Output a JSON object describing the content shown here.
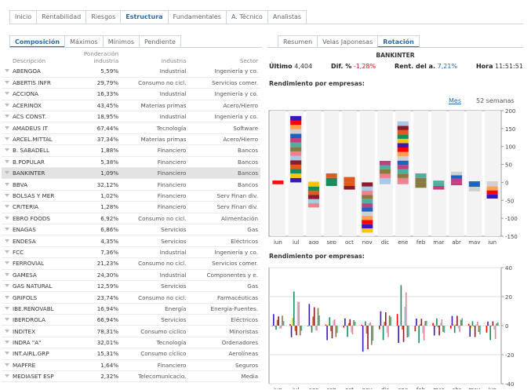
{
  "top_tabs": [
    "Inicio",
    "Rentabilidad",
    "Riesgos",
    "Estructura",
    "Fundamentales",
    "A. Técnico",
    "Analistas"
  ],
  "top_active": 3,
  "sub_tabs": [
    "Composición",
    "Máximos",
    "Mínimos",
    "Pendiente"
  ],
  "sub_active": 0,
  "table": {
    "headers": [
      "Descripción",
      "Ponderación industria",
      "Industria",
      "Sector"
    ],
    "rows": [
      [
        "ABENGOA",
        "5,59%",
        "Industrial",
        "Ingeniería y co."
      ],
      [
        "ABERTIS INFR",
        "29,79%",
        "Consumo no cicl.",
        "Servicios comer."
      ],
      [
        "ACCIONA",
        "16,33%",
        "Industrial",
        "Ingeniería y co."
      ],
      [
        "ACERINOX",
        "43,45%",
        "Materias primas",
        "Acero/Hierro"
      ],
      [
        "ACS CONST.",
        "18,95%",
        "Industrial",
        "Ingeniería y co."
      ],
      [
        "AMADEUS IT",
        "67,44%",
        "Tecnología",
        "Software"
      ],
      [
        "ARCEL.MITTAL",
        "37,34%",
        "Materias primas",
        "Acero/Hierro"
      ],
      [
        "B. SABADELL",
        "1,88%",
        "Financiero",
        "Bancos"
      ],
      [
        "B.POPULAR",
        "5,38%",
        "Financiero",
        "Bancos"
      ],
      [
        "BANKINTER",
        "1,09%",
        "Financiero",
        "Bancos"
      ],
      [
        "BBVA",
        "32,12%",
        "Financiero",
        "Bancos"
      ],
      [
        "BOLSAS Y MER",
        "1,02%",
        "Financiero",
        "Serv Finan div."
      ],
      [
        "CRITERIA",
        "1,28%",
        "Financiero",
        "Serv Finan div."
      ],
      [
        "EBRO FOODS",
        "6,92%",
        "Consumo no cicl.",
        "Alimentación"
      ],
      [
        "ENAGAS",
        "6,86%",
        "Servicios",
        "Gas"
      ],
      [
        "ENDESA",
        "4,35%",
        "Servicios",
        "Eléctricos"
      ],
      [
        "FCC",
        "7,36%",
        "Industrial",
        "Ingeniería y co."
      ],
      [
        "FERROVIAL",
        "21,23%",
        "Consumo no cicl.",
        "Servicios comer."
      ],
      [
        "GAMESA",
        "24,30%",
        "Industrial",
        "Componentes y e."
      ],
      [
        "GAS NATURAL",
        "12,59%",
        "Servicios",
        "Gas"
      ],
      [
        "GRIFOLS",
        "23,74%",
        "Consumo no cicl.",
        "Farmacéuticas"
      ],
      [
        "IBE.RENOVABL",
        "16,94%",
        "Energía",
        "Energía-Fuentes."
      ],
      [
        "IBERDROLA",
        "66,94%",
        "Servicios",
        "Eléctricos"
      ],
      [
        "INDITEX",
        "78,31%",
        "Consumo cíclico",
        "Minoristas"
      ],
      [
        "INDRA \"A\"",
        "32,01%",
        "Tecnología",
        "Ordenadores"
      ],
      [
        "INT.AIRL.GRP",
        "15,31%",
        "Consumo cíclico",
        "Aerolíneas"
      ],
      [
        "MAPFRE",
        "1,64%",
        "Financiero",
        "Seguros"
      ],
      [
        "MEDIASET ESP",
        "2,32%",
        "Telecomunicacio.",
        "Media"
      ]
    ],
    "selected_row": 9
  },
  "right_tabs": [
    "Resumen",
    "Velas Japonesas",
    "Rotación"
  ],
  "right_active": 2,
  "detail": {
    "title": "BANKINTER",
    "ultimo_label": "Último",
    "ultimo": "4,404",
    "dif_label": "Dif. %",
    "dif": "-1,28%",
    "rent_label": "Rent. del a.",
    "rent": "7,21%",
    "hora_label": "Hora",
    "hora": "11:51:51"
  },
  "section1": "Rendimiento por empresas:",
  "section2": "Rendimiento por empresas:",
  "period_mes": "Mes",
  "period_52": "52 semanas",
  "colors": {
    "accent": "#2a6aa6",
    "neg": "#cc2020",
    "pos": "#2a6aa6"
  },
  "chart_data": [
    {
      "type": "bar",
      "title": "Rendimiento por empresas:",
      "categories": [
        "jun",
        "jul",
        "ago",
        "sep",
        "oct",
        "nov",
        "dic",
        "ene",
        "feb",
        "mar",
        "abr",
        "may",
        "jun"
      ],
      "stacked": true,
      "ylim": [
        -150,
        200
      ],
      "yticks": [
        200,
        150,
        100,
        50,
        0,
        -50,
        -100,
        -150
      ],
      "positive_totals": [
        5,
        185,
        2,
        25,
        15,
        0,
        60,
        170,
        25,
        5,
        30,
        3,
        3
      ],
      "negative_totals": [
        -5,
        0,
        -70,
        -10,
        -20,
        -140,
        -5,
        -5,
        -15,
        -20,
        -8,
        -25,
        -45
      ],
      "grid": true
    },
    {
      "type": "bar",
      "title": "Rendimiento por empresas:",
      "categories": [
        "jun",
        "jul",
        "ago",
        "sep",
        "oct",
        "nov",
        "dic",
        "ene",
        "feb",
        "mar",
        "abr",
        "may",
        "jun"
      ],
      "ylim": [
        -40,
        40
      ],
      "yticks": [
        40,
        20,
        0,
        -20,
        -40
      ],
      "group_ranges": [
        [
          -3,
          8
        ],
        [
          -8,
          25
        ],
        [
          -5,
          15
        ],
        [
          -10,
          6
        ],
        [
          -8,
          5
        ],
        [
          -18,
          3
        ],
        [
          -10,
          10
        ],
        [
          -12,
          28
        ],
        [
          -12,
          5
        ],
        [
          -7,
          5
        ],
        [
          -5,
          7
        ],
        [
          -8,
          3
        ],
        [
          -10,
          3
        ]
      ],
      "grid": true
    }
  ]
}
